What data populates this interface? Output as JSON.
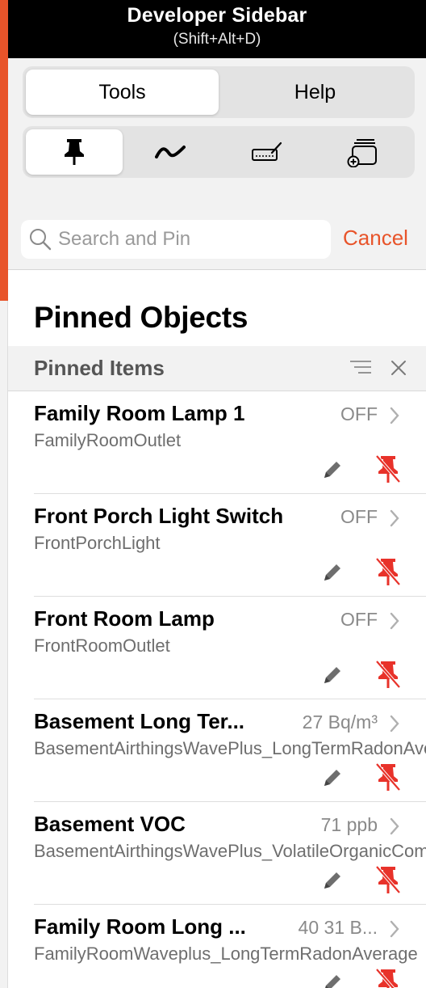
{
  "header": {
    "title": "Developer Sidebar",
    "shortcut": "(Shift+Alt+D)"
  },
  "tabs": [
    {
      "label": "Tools",
      "active": true
    },
    {
      "label": "Help",
      "active": false
    }
  ],
  "tool_icons": [
    {
      "icon": "pin-icon",
      "active": true
    },
    {
      "icon": "graph-icon",
      "active": false
    },
    {
      "icon": "keyboard-pen-icon",
      "active": false
    },
    {
      "icon": "add-window-icon",
      "active": false
    }
  ],
  "search": {
    "placeholder": "Search and Pin",
    "cancel_label": "Cancel"
  },
  "pinned": {
    "title": "Pinned Objects",
    "section_label": "Pinned Items",
    "items": [
      {
        "name": "Family Room Lamp 1",
        "device": "FamilyRoomOutlet",
        "value": "OFF"
      },
      {
        "name": "Front Porch Light Switch",
        "device": "FrontPorchLight",
        "value": "OFF"
      },
      {
        "name": "Front Room Lamp",
        "device": "FrontRoomOutlet",
        "value": "OFF"
      },
      {
        "name": "Basement Long Ter...",
        "device": "BasementAirthingsWavePlus_LongTermRadonAverage",
        "value": "27 Bq/m³"
      },
      {
        "name": "Basement VOC",
        "device": "BasementAirthingsWavePlus_VolatileOrganicCompounds",
        "value": "71 ppb"
      },
      {
        "name": "Family Room Long ...",
        "device": "FamilyRoomWaveplus_LongTermRadonAverage",
        "value": "40 31 B..."
      }
    ]
  },
  "colors": {
    "accent": "#e8542a",
    "unpin": "#e8322a",
    "panel": "#f2f2f2"
  }
}
